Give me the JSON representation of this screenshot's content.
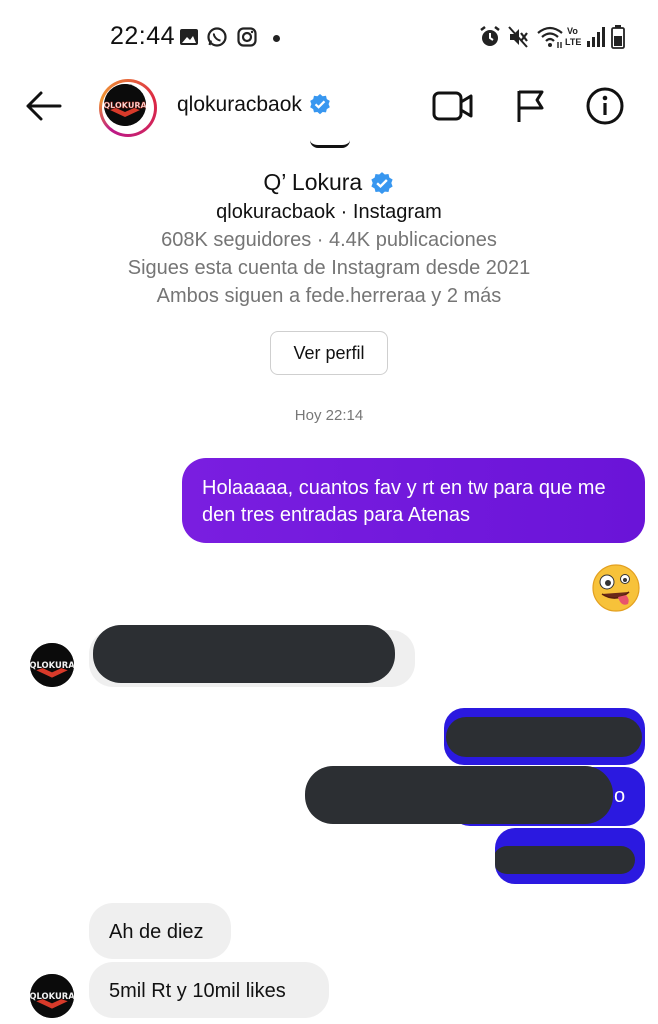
{
  "status_bar": {
    "time": "22:44",
    "left_icons": [
      "image-icon",
      "whatsapp-icon",
      "instagram-icon"
    ],
    "right_icons": [
      "alarm-icon",
      "mute-icon",
      "wifi-icon",
      "volte-icon",
      "signal-icon",
      "battery-icon"
    ],
    "volte_label": "Vo\nLTE"
  },
  "header": {
    "username": "qlokuracbaok",
    "avatar_logo_text": "QLOKURA",
    "buttons": [
      "video-call-icon",
      "flag-icon",
      "info-icon"
    ]
  },
  "profile": {
    "display_name": "Q’ Lokura",
    "handle_line": "qlokuracbaok · Instagram",
    "stats": "608K seguidores · 4.4K publicaciones",
    "since": "Sigues esta cuenta de Instagram desde 2021",
    "mutual": "Ambos siguen a fede.herreraa y 2 más",
    "view_profile_label": "Ver perfil"
  },
  "thread": {
    "timestamp": "Hoy 22:14",
    "messages": [
      {
        "from": "me",
        "text": "Holaaaaa, cuantos fav y rt en tw para que me den tres entradas para Atenas"
      },
      {
        "from": "me",
        "type": "reaction",
        "emoji": "🤪"
      },
      {
        "from": "them",
        "redacted": true
      },
      {
        "from": "me",
        "redacted": true
      },
      {
        "from": "me",
        "redacted": true,
        "visible_tail": "o"
      },
      {
        "from": "me",
        "redacted": true
      },
      {
        "from": "them",
        "text": "Ah de diez"
      },
      {
        "from": "them",
        "text": "5mil Rt y 10mil likes"
      }
    ]
  },
  "colors": {
    "sent_gradient_start": "#7a1ee0",
    "sent_gradient_end": "#6a14d8",
    "sent_blue": "#2b19e0",
    "received_bg": "#efefef",
    "verified_blue": "#3897f0",
    "redaction": "#2c2f33"
  }
}
